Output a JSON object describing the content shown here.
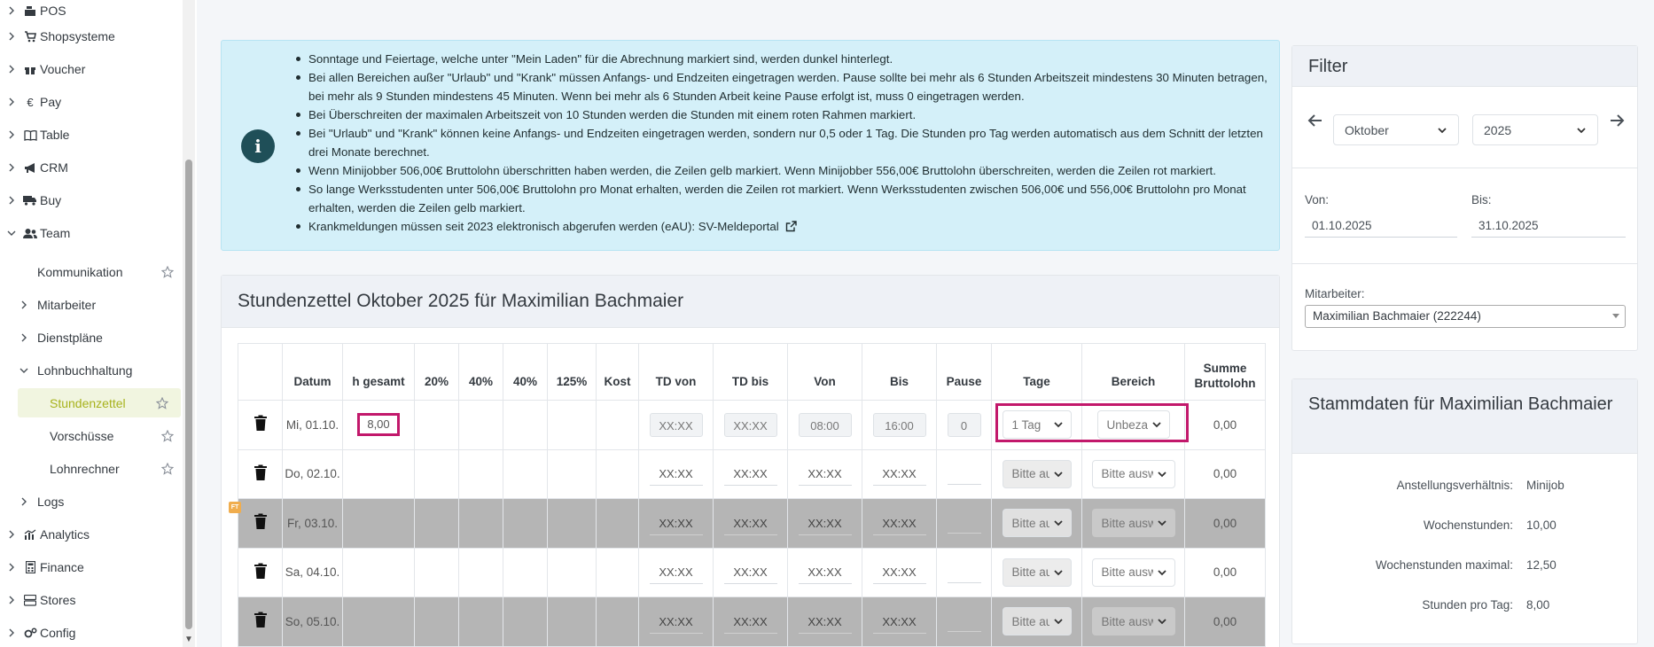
{
  "sidebar": {
    "items": [
      {
        "label": "POS",
        "icon": "cash-register-icon",
        "expand": "closed"
      },
      {
        "label": "Shopsysteme",
        "icon": "cart-icon",
        "expand": "closed"
      },
      {
        "label": "Voucher",
        "icon": "gift-icon",
        "expand": "closed"
      },
      {
        "label": "Pay",
        "icon": "euro-icon",
        "expand": "closed"
      },
      {
        "label": "Table",
        "icon": "book-icon",
        "expand": "closed"
      },
      {
        "label": "CRM",
        "icon": "megaphone-icon",
        "expand": "closed"
      },
      {
        "label": "Buy",
        "icon": "truck-icon",
        "expand": "closed"
      },
      {
        "label": "Team",
        "icon": "users-icon",
        "expand": "open"
      }
    ],
    "team_children": [
      {
        "label": "Kommunikation",
        "star": true
      },
      {
        "label": "Mitarbeiter",
        "expand": "closed"
      },
      {
        "label": "Dienstpläne",
        "expand": "closed"
      },
      {
        "label": "Lohnbuchhaltung",
        "expand": "open"
      }
    ],
    "lohn_children": [
      {
        "label": "Stundenzettel",
        "active": true
      },
      {
        "label": "Vorschüsse"
      },
      {
        "label": "Lohnrechner"
      }
    ],
    "logs": {
      "label": "Logs"
    },
    "bottom_items": [
      {
        "label": "Analytics",
        "icon": "chart-icon"
      },
      {
        "label": "Finance",
        "icon": "calculator-icon"
      },
      {
        "label": "Stores",
        "icon": "stores-icon"
      },
      {
        "label": "Config",
        "icon": "config-icon"
      }
    ]
  },
  "info": {
    "bullets": [
      "Sonntage und Feiertage, welche unter \"Mein Laden\" für die Abrechnung markiert sind, werden dunkel hinterlegt.",
      "Bei allen Bereichen außer \"Urlaub\" und \"Krank\" müssen Anfangs- und Endzeiten eingetragen werden. Pause sollte bei mehr als 6 Stunden Arbeitszeit mindestens 30 Minuten betragen, bei mehr als 9 Stunden mindestens 45 Minuten. Wenn bei mehr als 6 Stunden Arbeit keine Pause erfolgt ist, muss 0 eingetragen werden.",
      "Bei Überschreiten der maximalen Arbeitszeit von 10 Stunden werden die Stunden mit einem roten Rahmen markiert.",
      "Bei \"Urlaub\" und \"Krank\" können keine Anfangs- und Endzeiten eingetragen werden, sondern nur 0,5 oder 1 Tag. Die Stunden pro Tag werden automatisch aus dem Schnitt der letzten drei Monate berechnet.",
      "Wenn Minijobber 506,00€ Bruttolohn überschritten haben werden, die Zeilen gelb markiert. Wenn Minijobber 556,00€ Bruttolohn überschreiten, werden die Zeilen rot markiert.",
      "So lange Werksstudenten unter 506,00€ Bruttolohn pro Monat erhalten, werden die Zeilen rot markiert. Wenn Werksstudenten zwischen 506,00€ und 556,00€ Bruttolohn pro Monat erhalten, werden die Zeilen gelb markiert."
    ],
    "last_bullet": "Krankmeldungen müssen seit 2023 elektronisch abgerufen werden (eAU):",
    "last_link": "SV-Meldeportal"
  },
  "timesheet": {
    "title": "Stundenzettel Oktober 2025 für Maximilian Bachmaier",
    "columns": [
      "",
      "Datum",
      "h gesamt",
      "20%",
      "40%",
      "40%",
      "125%",
      "Kost",
      "TD von",
      "TD bis",
      "Von",
      "Bis",
      "Pause",
      "Tage",
      "Bereich",
      "Summe Bruttolohn"
    ],
    "rows": [
      {
        "date": "Mi, 01.10.",
        "hours": "8,00",
        "td_von": "XX:XX",
        "td_bis": "XX:XX",
        "von": "08:00",
        "bis": "16:00",
        "pause": "0",
        "tage": "1 Tag",
        "bereich": "Unbezahlt",
        "sum": "0,00",
        "dark": false,
        "filled": true
      },
      {
        "date": "Do, 02.10.",
        "hours": "",
        "td_von": "XX:XX",
        "td_bis": "XX:XX",
        "von": "XX:XX",
        "bis": "XX:XX",
        "pause": "",
        "tage": "Bitte auswählen",
        "bereich": "Bitte auswählen",
        "sum": "0,00",
        "dark": false,
        "filled": false
      },
      {
        "date": "Fr, 03.10.",
        "hours": "",
        "td_von": "XX:XX",
        "td_bis": "XX:XX",
        "von": "XX:XX",
        "bis": "XX:XX",
        "pause": "",
        "tage": "Bitte auswählen",
        "bereich": "Bitte auswählen",
        "sum": "0,00",
        "dark": true,
        "filled": false,
        "badge": "FT"
      },
      {
        "date": "Sa, 04.10.",
        "hours": "",
        "td_von": "XX:XX",
        "td_bis": "XX:XX",
        "von": "XX:XX",
        "bis": "XX:XX",
        "pause": "",
        "tage": "Bitte auswählen",
        "bereich": "Bitte auswählen",
        "sum": "0,00",
        "dark": false,
        "filled": false
      },
      {
        "date": "So, 05.10.",
        "hours": "",
        "td_von": "XX:XX",
        "td_bis": "XX:XX",
        "von": "XX:XX",
        "bis": "XX:XX",
        "pause": "",
        "tage": "Bitte auswählen",
        "bereich": "Bitte auswählen",
        "sum": "0,00",
        "dark": true,
        "filled": false
      }
    ]
  },
  "filter": {
    "title": "Filter",
    "month": "Oktober",
    "year": "2025",
    "von_label": "Von:",
    "von_value": "01.10.2025",
    "bis_label": "Bis:",
    "bis_value": "31.10.2025",
    "employee_label": "Mitarbeiter:",
    "employee_value": "Maximilian Bachmaier (222244)"
  },
  "stammdaten": {
    "title": "Stammdaten für Maximilian Bachmaier",
    "fields": [
      {
        "label": "Anstellungsverhältnis:",
        "value": "Minijob"
      },
      {
        "label": "Wochenstunden:",
        "value": "10,00"
      },
      {
        "label": "Wochenstunden maximal:",
        "value": "12,50"
      },
      {
        "label": "Stunden pro Tag:",
        "value": "8,00"
      }
    ]
  },
  "colors": {
    "info_bg": "#d4f0f9",
    "highlight": "#c2186b",
    "active_nav": "#a7b21c",
    "dark_row": "#b5b5b5"
  }
}
